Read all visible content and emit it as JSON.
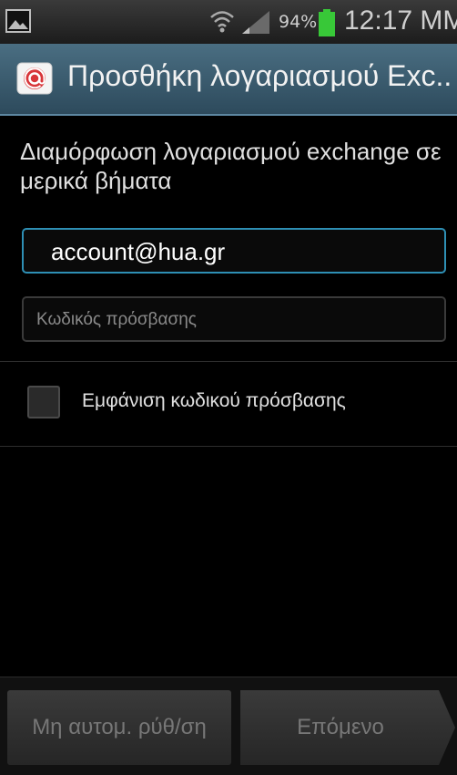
{
  "status_bar": {
    "battery_percent": "94%",
    "time": "12:17 MM",
    "icons": [
      "gallery-icon",
      "wifi-icon",
      "signal-icon",
      "battery-icon"
    ],
    "battery_color": "#38c838"
  },
  "action_bar": {
    "title": "Προσθήκη λογαριασμού Exc..",
    "icon": "email-app-icon",
    "accent": "#4a6e82"
  },
  "content": {
    "intro_text": "Διαμόρφωση λογαριασμού exchange σε μερικά βήματα",
    "email_value": "account@hua.gr",
    "password_placeholder": "Κωδικός πρόσβασης",
    "show_password_label": "Εμφάνιση κωδικού πρόσβασης",
    "show_password_checked": false
  },
  "bottom_bar": {
    "manual_setup_label": "Μη αυτομ. ρύθ/ση",
    "next_label": "Επόμενο"
  }
}
